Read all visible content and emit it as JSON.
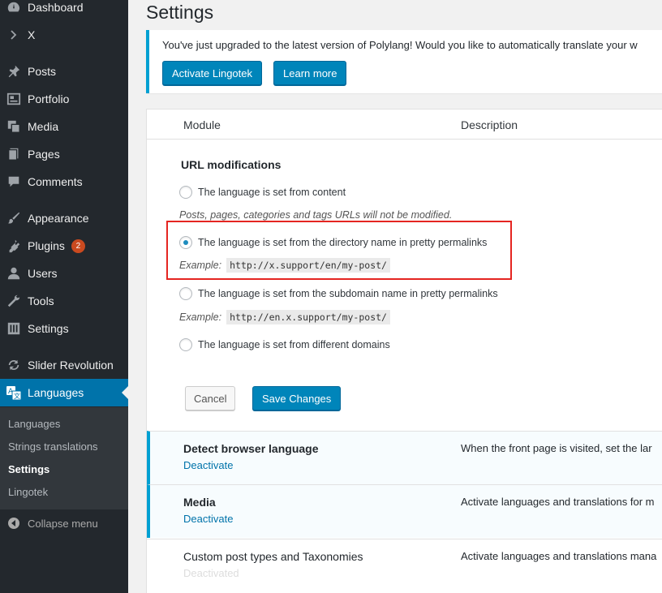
{
  "sidebar": {
    "items": [
      {
        "label": "Dashboard",
        "icon": "dashboard-icon"
      },
      {
        "label": "X",
        "icon": "chevron-right-icon"
      },
      {
        "label": "Posts",
        "icon": "pin-icon"
      },
      {
        "label": "Portfolio",
        "icon": "portfolio-icon"
      },
      {
        "label": "Media",
        "icon": "media-icon"
      },
      {
        "label": "Pages",
        "icon": "pages-icon"
      },
      {
        "label": "Comments",
        "icon": "comment-icon"
      },
      {
        "label": "Appearance",
        "icon": "brush-icon"
      },
      {
        "label": "Plugins",
        "icon": "plugin-icon",
        "badge": "2"
      },
      {
        "label": "Users",
        "icon": "user-icon"
      },
      {
        "label": "Tools",
        "icon": "wrench-icon"
      },
      {
        "label": "Settings",
        "icon": "settings-icon"
      },
      {
        "label": "Slider Revolution",
        "icon": "refresh-icon"
      },
      {
        "label": "Languages",
        "icon": "translate-icon"
      }
    ],
    "submenu": [
      "Languages",
      "Strings translations",
      "Settings",
      "Lingotek"
    ],
    "collapse_label": "Collapse menu"
  },
  "page": {
    "title": "Settings"
  },
  "notice": {
    "text": "You've just upgraded to the latest version of Polylang! Would you like to automatically translate your w",
    "activate_label": "Activate Lingotek",
    "learn_label": "Learn more"
  },
  "table": {
    "col_module": "Module",
    "col_description": "Description"
  },
  "url_mod": {
    "title": "URL modifications",
    "option1": "The language is set from content",
    "option1_desc": "Posts, pages, categories and tags URLs will not be modified.",
    "option2": "The language is set from the directory name in pretty permalinks",
    "example_label": "Example:",
    "option2_example": "http://x.support/en/my-post/",
    "option3": "The language is set from the subdomain name in pretty permalinks",
    "option3_example": "http://en.x.support/my-post/",
    "option4": "The language is set from different domains",
    "cancel_label": "Cancel",
    "save_label": "Save Changes"
  },
  "modules": [
    {
      "name": "Detect browser language",
      "action": "Deactivate",
      "description": "When the front page is visited, set the lar"
    },
    {
      "name": "Media",
      "action": "Deactivate",
      "description": "Activate languages and translations for m"
    },
    {
      "name": "Custom post types and Taxonomies",
      "action": "Deactivated",
      "description": "Activate languages and translations mana"
    }
  ],
  "colors": {
    "accent": "#0073aa",
    "highlight": "#e52521"
  }
}
